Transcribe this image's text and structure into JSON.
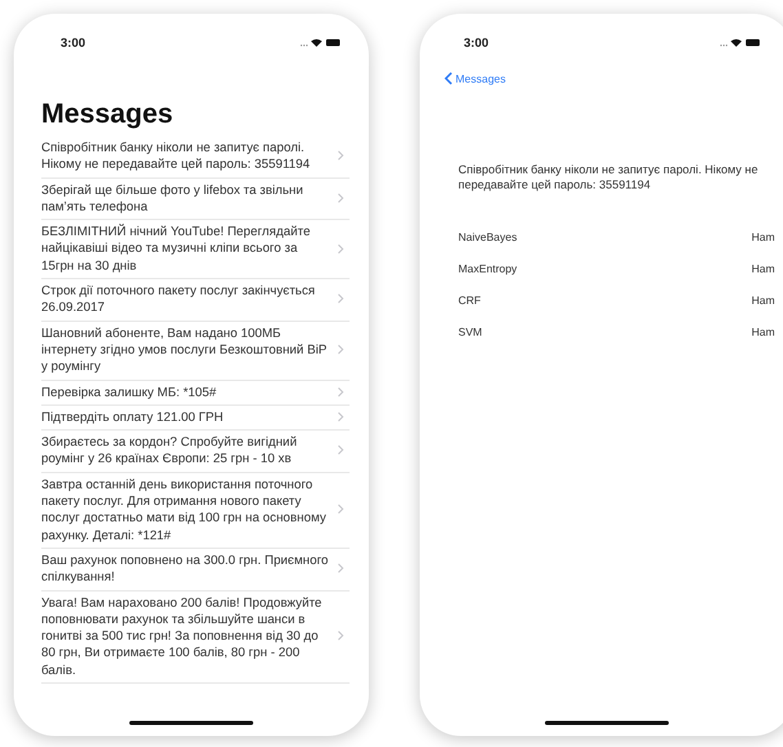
{
  "list_screen": {
    "status_bar": {
      "time": "3:00"
    },
    "title": "Messages",
    "messages": [
      {
        "text": "Співробітник банку ніколи не запитує паролі. Нікому не передавайте цей пароль: 35591194"
      },
      {
        "text": "Зберігай ще більше фото у lifebox та звільни пам’ять телефона"
      },
      {
        "text": "БЕЗЛІМІТНИЙ нічний YouTube! Переглядайте найцікавіші відео та музичні кліпи всього за 15грн на 30 днів"
      },
      {
        "text": "Строк дії поточного пакету послуг закінчується 26.09.2017"
      },
      {
        "text": "Шановний абоненте, Вам надано 100МБ інтернету згідно умов послуги Безкоштовний ВіP у роумінгу"
      },
      {
        "text": "Перевірка залишку МБ: *105#"
      },
      {
        "text": "Підтвердіть оплату  121.00 ГРН"
      },
      {
        "text": "Збираєтесь за кордон? Спробуйте вигідний роумінг у 26 країнах Європи: 25 грн - 10 хв"
      },
      {
        "text": "Завтра останній день використання поточного пакету послуг. Для отримання нового пакету послуг достатньо мати від 100 грн на основному рахунку. Деталі: *121#"
      },
      {
        "text": "Ваш рахунок поповнено на 300.0 грн. Приємного спілкування!"
      },
      {
        "text": "Увага! Вам нараховано 200 балів! Продовжуйте поповнювати рахунок та збільшуйте шанси в гонитві за 500 тис грн! За поповнення від 30 до 80 грн, Ви отримаєте 100 балів, 80 грн - 200 балів."
      }
    ]
  },
  "detail_screen": {
    "status_bar": {
      "time": "3:00"
    },
    "back_label": "Messages",
    "message": "Співробітник банку ніколи не запитує паролі. Нікому не передавайте цей пароль: 35591194",
    "results": [
      {
        "classifier": "NaiveBayes",
        "label": "Ham"
      },
      {
        "classifier": "MaxEntropy",
        "label": "Ham"
      },
      {
        "classifier": "CRF",
        "label": "Ham"
      },
      {
        "classifier": "SVM",
        "label": "Ham"
      }
    ]
  }
}
